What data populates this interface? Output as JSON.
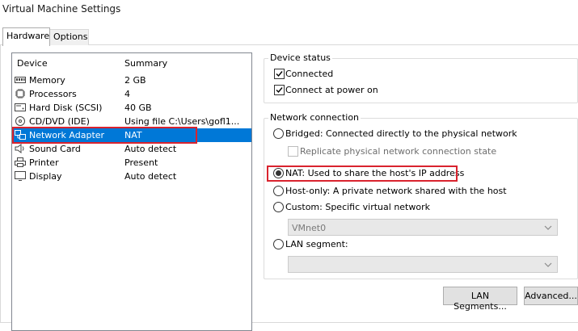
{
  "window": {
    "title": "Virtual Machine Settings"
  },
  "tabs": [
    {
      "label": "Hardware"
    },
    {
      "label": "Options"
    }
  ],
  "device_list": {
    "columns": {
      "device": "Device",
      "summary": "Summary"
    },
    "rows": [
      {
        "icon": "memory-icon",
        "device": "Memory",
        "summary": "2 GB"
      },
      {
        "icon": "processor-icon",
        "device": "Processors",
        "summary": "4"
      },
      {
        "icon": "hard-disk-icon",
        "device": "Hard Disk (SCSI)",
        "summary": "40 GB"
      },
      {
        "icon": "cd-dvd-icon",
        "device": "CD/DVD (IDE)",
        "summary": "Using file C:\\Users\\gofl1..."
      },
      {
        "icon": "network-adapter-icon",
        "device": "Network Adapter",
        "summary": "NAT",
        "selected": true
      },
      {
        "icon": "sound-card-icon",
        "device": "Sound Card",
        "summary": "Auto detect"
      },
      {
        "icon": "printer-icon",
        "device": "Printer",
        "summary": "Present"
      },
      {
        "icon": "display-icon",
        "device": "Display",
        "summary": "Auto detect"
      }
    ]
  },
  "device_status": {
    "label": "Device status",
    "connected": {
      "label": "Connected",
      "checked": true
    },
    "connect_at_power_on": {
      "label": "Connect at power on",
      "checked": true
    }
  },
  "network_connection": {
    "label": "Network connection",
    "bridged": {
      "label": "Bridged: Connected directly to the physical network",
      "selected": false
    },
    "replicate": {
      "label": "Replicate physical network connection state",
      "checked": false,
      "disabled": true
    },
    "nat": {
      "label": "NAT: Used to share the host's IP address",
      "selected": true
    },
    "host_only": {
      "label": "Host-only: A private network shared with the host",
      "selected": false
    },
    "custom": {
      "label": "Custom: Specific virtual network",
      "selected": false
    },
    "custom_select": {
      "value": "VMnet0"
    },
    "lan_segment": {
      "label": "LAN segment:",
      "selected": false
    },
    "lan_select": {
      "value": ""
    }
  },
  "buttons": {
    "lan_segments": "LAN Segments...",
    "advanced": "Advanced..."
  },
  "colors": {
    "selection": "#0078d7",
    "highlight_box": "#d9232e"
  }
}
